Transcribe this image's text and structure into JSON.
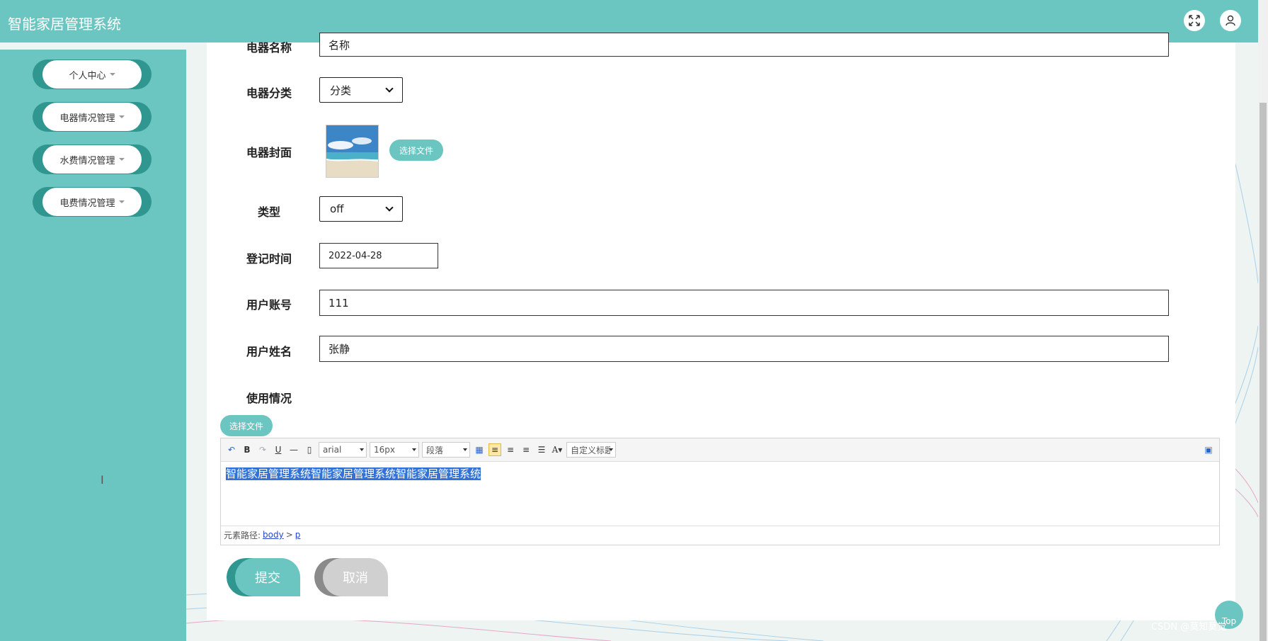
{
  "header": {
    "title": "智能家居管理系统"
  },
  "sidebar": {
    "items": [
      {
        "label": "个人中心"
      },
      {
        "label": "电器情况管理"
      },
      {
        "label": "水费情况管理"
      },
      {
        "label": "电费情况管理"
      }
    ]
  },
  "form": {
    "name": {
      "label": "电器名称",
      "value": "名称"
    },
    "category": {
      "label": "电器分类",
      "value": "分类"
    },
    "cover": {
      "label": "电器封面",
      "button": "选择文件"
    },
    "type": {
      "label": "类型",
      "value": "off"
    },
    "reg_time": {
      "label": "登记时间",
      "value": "2022-04-28"
    },
    "account": {
      "label": "用户账号",
      "value": "111"
    },
    "username": {
      "label": "用户姓名",
      "value": "张静"
    },
    "usage": {
      "label": "使用情况",
      "upload_button": "选择文件"
    }
  },
  "editor": {
    "font": "arial",
    "size": "16px",
    "paragraph": "段落",
    "custom_title": "自定义标题",
    "content": "智能家居管理系统智能家居管理系统智能家居管理系统",
    "path_label": "元素路径:",
    "path_body": "body",
    "path_sep": ">",
    "path_p": "p"
  },
  "actions": {
    "submit": "提交",
    "cancel": "取消"
  },
  "top_button": "Top",
  "watermark": "CSDN @莫知莫觉",
  "colors": {
    "accent": "#6bc6c1",
    "accent_dark": "#2f9690",
    "cancel_bg": "#d0d0d0",
    "selection": "#3271d6"
  }
}
